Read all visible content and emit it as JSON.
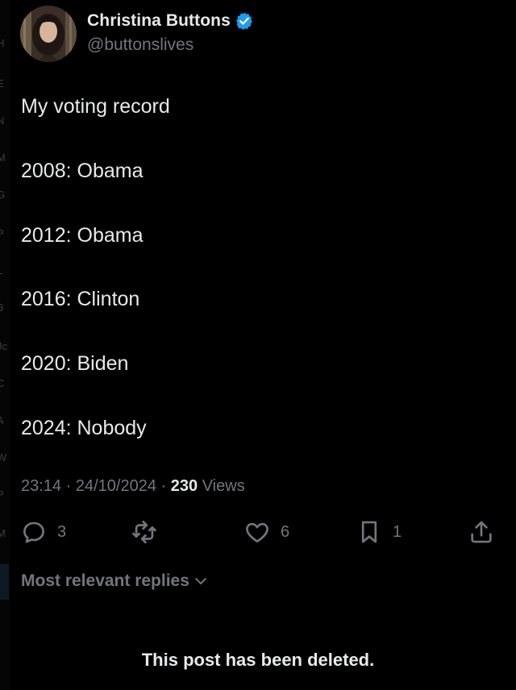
{
  "author": {
    "display_name": "Christina Buttons",
    "handle": "@buttonslives",
    "verified": true,
    "avatar_icon": "profile-photo"
  },
  "post": {
    "lines": [
      "My voting record",
      "2008: Obama",
      "2012: Obama",
      "2016: Clinton",
      "2020: Biden",
      "2024: Nobody"
    ],
    "time": "23:14",
    "date": "24/10/2024",
    "separator": "·",
    "views_count": "230",
    "views_label": "Views"
  },
  "actions": {
    "reply_count": "3",
    "repost_count": "",
    "like_count": "6",
    "bookmark_count": "1",
    "icons": [
      "reply-icon",
      "repost-icon",
      "like-icon",
      "bookmark-icon",
      "share-icon"
    ]
  },
  "replies": {
    "sort_label": "Most relevant replies",
    "sort_icon": "chevron-down-icon",
    "deleted_notice": "This post has been deleted."
  },
  "edge_fragments": [
    "H",
    "E",
    "N",
    "M",
    "G",
    "P",
    "L",
    "B",
    "Jc",
    "C",
    "A",
    "W",
    "P",
    "M"
  ],
  "colors": {
    "background": "#000000",
    "primary_text": "#e7e9ea",
    "secondary_text": "#71767b",
    "verified_blue": "#1d9bf0"
  }
}
